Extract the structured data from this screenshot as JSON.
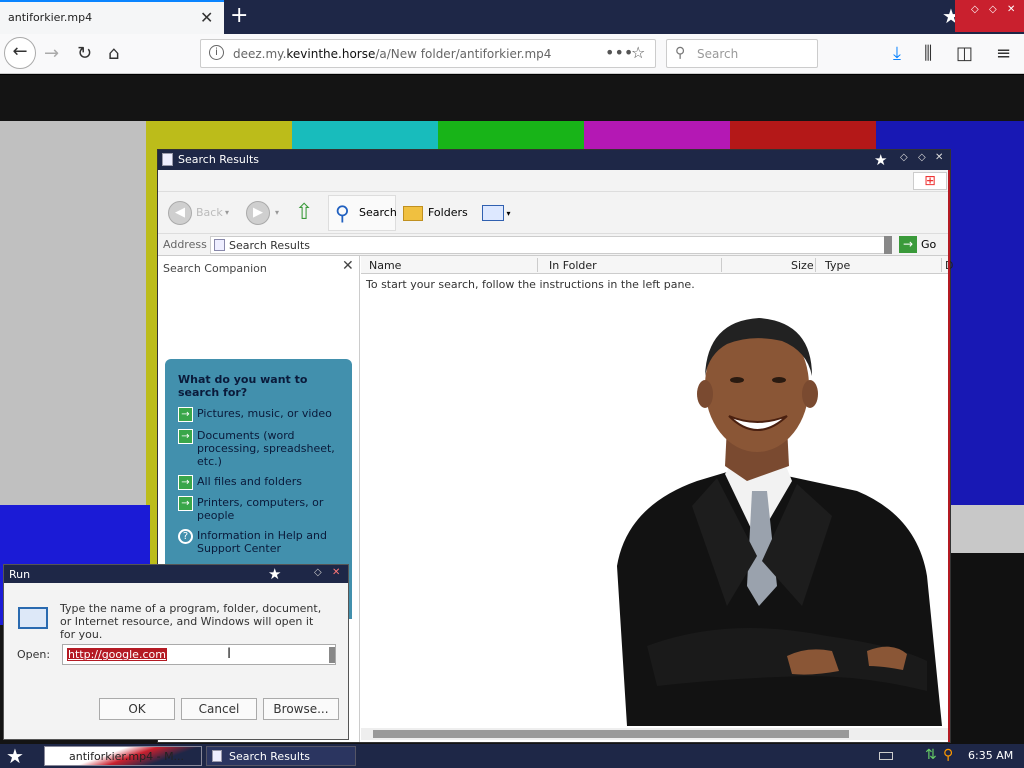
{
  "browser": {
    "tab_title": "antiforkier.mp4",
    "url_host_pre": "deez.my.",
    "url_host_bold": "kevinthe.horse",
    "url_path": "/a/New folder/antiforkier.mp4",
    "search_placeholder": "Search"
  },
  "colors": {
    "bars": [
      "#c0c0c0",
      "#bcbc1a",
      "#18bcbc",
      "#18b418",
      "#b418b4",
      "#b41818",
      "#1818b4"
    ],
    "titlebar": "#1e2747",
    "accent_red": "#c9202e"
  },
  "search_window": {
    "title": "Search Results",
    "toolbar": {
      "back": "Back",
      "search": "Search",
      "folders": "Folders"
    },
    "address": {
      "label": "Address",
      "value": "Search Results",
      "go": "Go"
    },
    "companion": {
      "title": "Search Companion",
      "question": "What do you want to search for?",
      "options": [
        "Pictures, music, or video",
        "Documents (word processing, spreadsheet, etc.)",
        "All files and folders",
        "Printers, computers, or people",
        "Information in Help and Support Center"
      ]
    },
    "columns": [
      "Name",
      "In Folder",
      "Size",
      "Type",
      "D"
    ],
    "hint": "To start your search, follow the instructions in the left pane."
  },
  "run_dialog": {
    "title": "Run",
    "description": "Type the name of a program, folder, document, or Internet resource, and Windows will open it for you.",
    "open_label": "Open:",
    "open_value": "http://google.com",
    "ok": "OK",
    "cancel": "Cancel",
    "browse": "Browse..."
  },
  "taskbar": {
    "task1": "antiforkier.mp4 - M...",
    "task2": "Search Results",
    "clock": "6:35 AM"
  }
}
